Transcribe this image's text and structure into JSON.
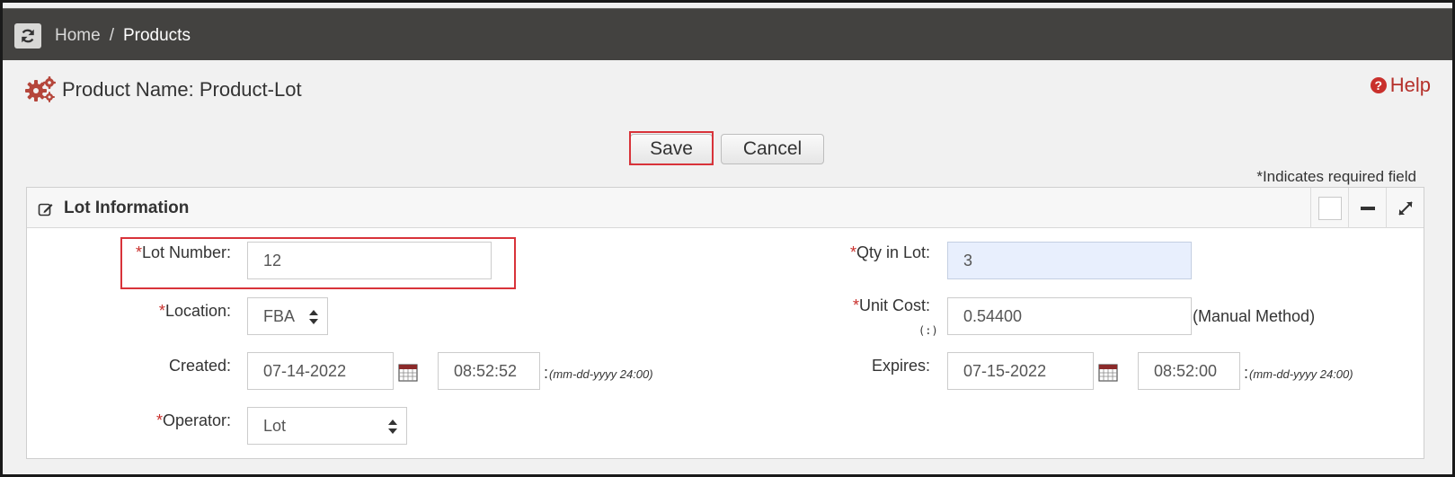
{
  "nav": {
    "refresh_icon": "refresh-icon",
    "breadcrumb": [
      "Home",
      "Products"
    ],
    "separator": "/"
  },
  "header": {
    "title": "Product Name: Product-Lot",
    "help_label": "Help",
    "help_icon": "question-circle-icon"
  },
  "actions": {
    "save_label": "Save",
    "cancel_label": "Cancel"
  },
  "required_note": "*Indicates required field",
  "panel": {
    "title": "Lot Information",
    "icon": "edit-icon"
  },
  "form": {
    "lot_number": {
      "label": "Lot Number:",
      "required": "*",
      "value": "12"
    },
    "location": {
      "label": "Location:",
      "required": "*",
      "value": "FBA"
    },
    "created": {
      "label": "Created:",
      "date": "07-14-2022",
      "time": "08:52:52",
      "sep": ":",
      "format": "(mm-dd-yyyy 24:00)"
    },
    "operator": {
      "label": "Operator:",
      "required": "*",
      "value": "Lot"
    },
    "qty_in_lot": {
      "label": "Qty in Lot:",
      "required": "*",
      "value": "3"
    },
    "unit_cost": {
      "label": "Unit Cost:",
      "required": "*",
      "sub": "(:)",
      "value": "0.54400",
      "method": "(Manual Method)"
    },
    "expires": {
      "label": "Expires:",
      "date": "07-15-2022",
      "time": "08:52:00",
      "sep": ":",
      "format": "(mm-dd-yyyy 24:00)"
    }
  },
  "colors": {
    "navbar": "#434240",
    "accent_red": "#c9302c",
    "highlight": "#d8333a",
    "qty_field_bg": "#e8effd"
  }
}
